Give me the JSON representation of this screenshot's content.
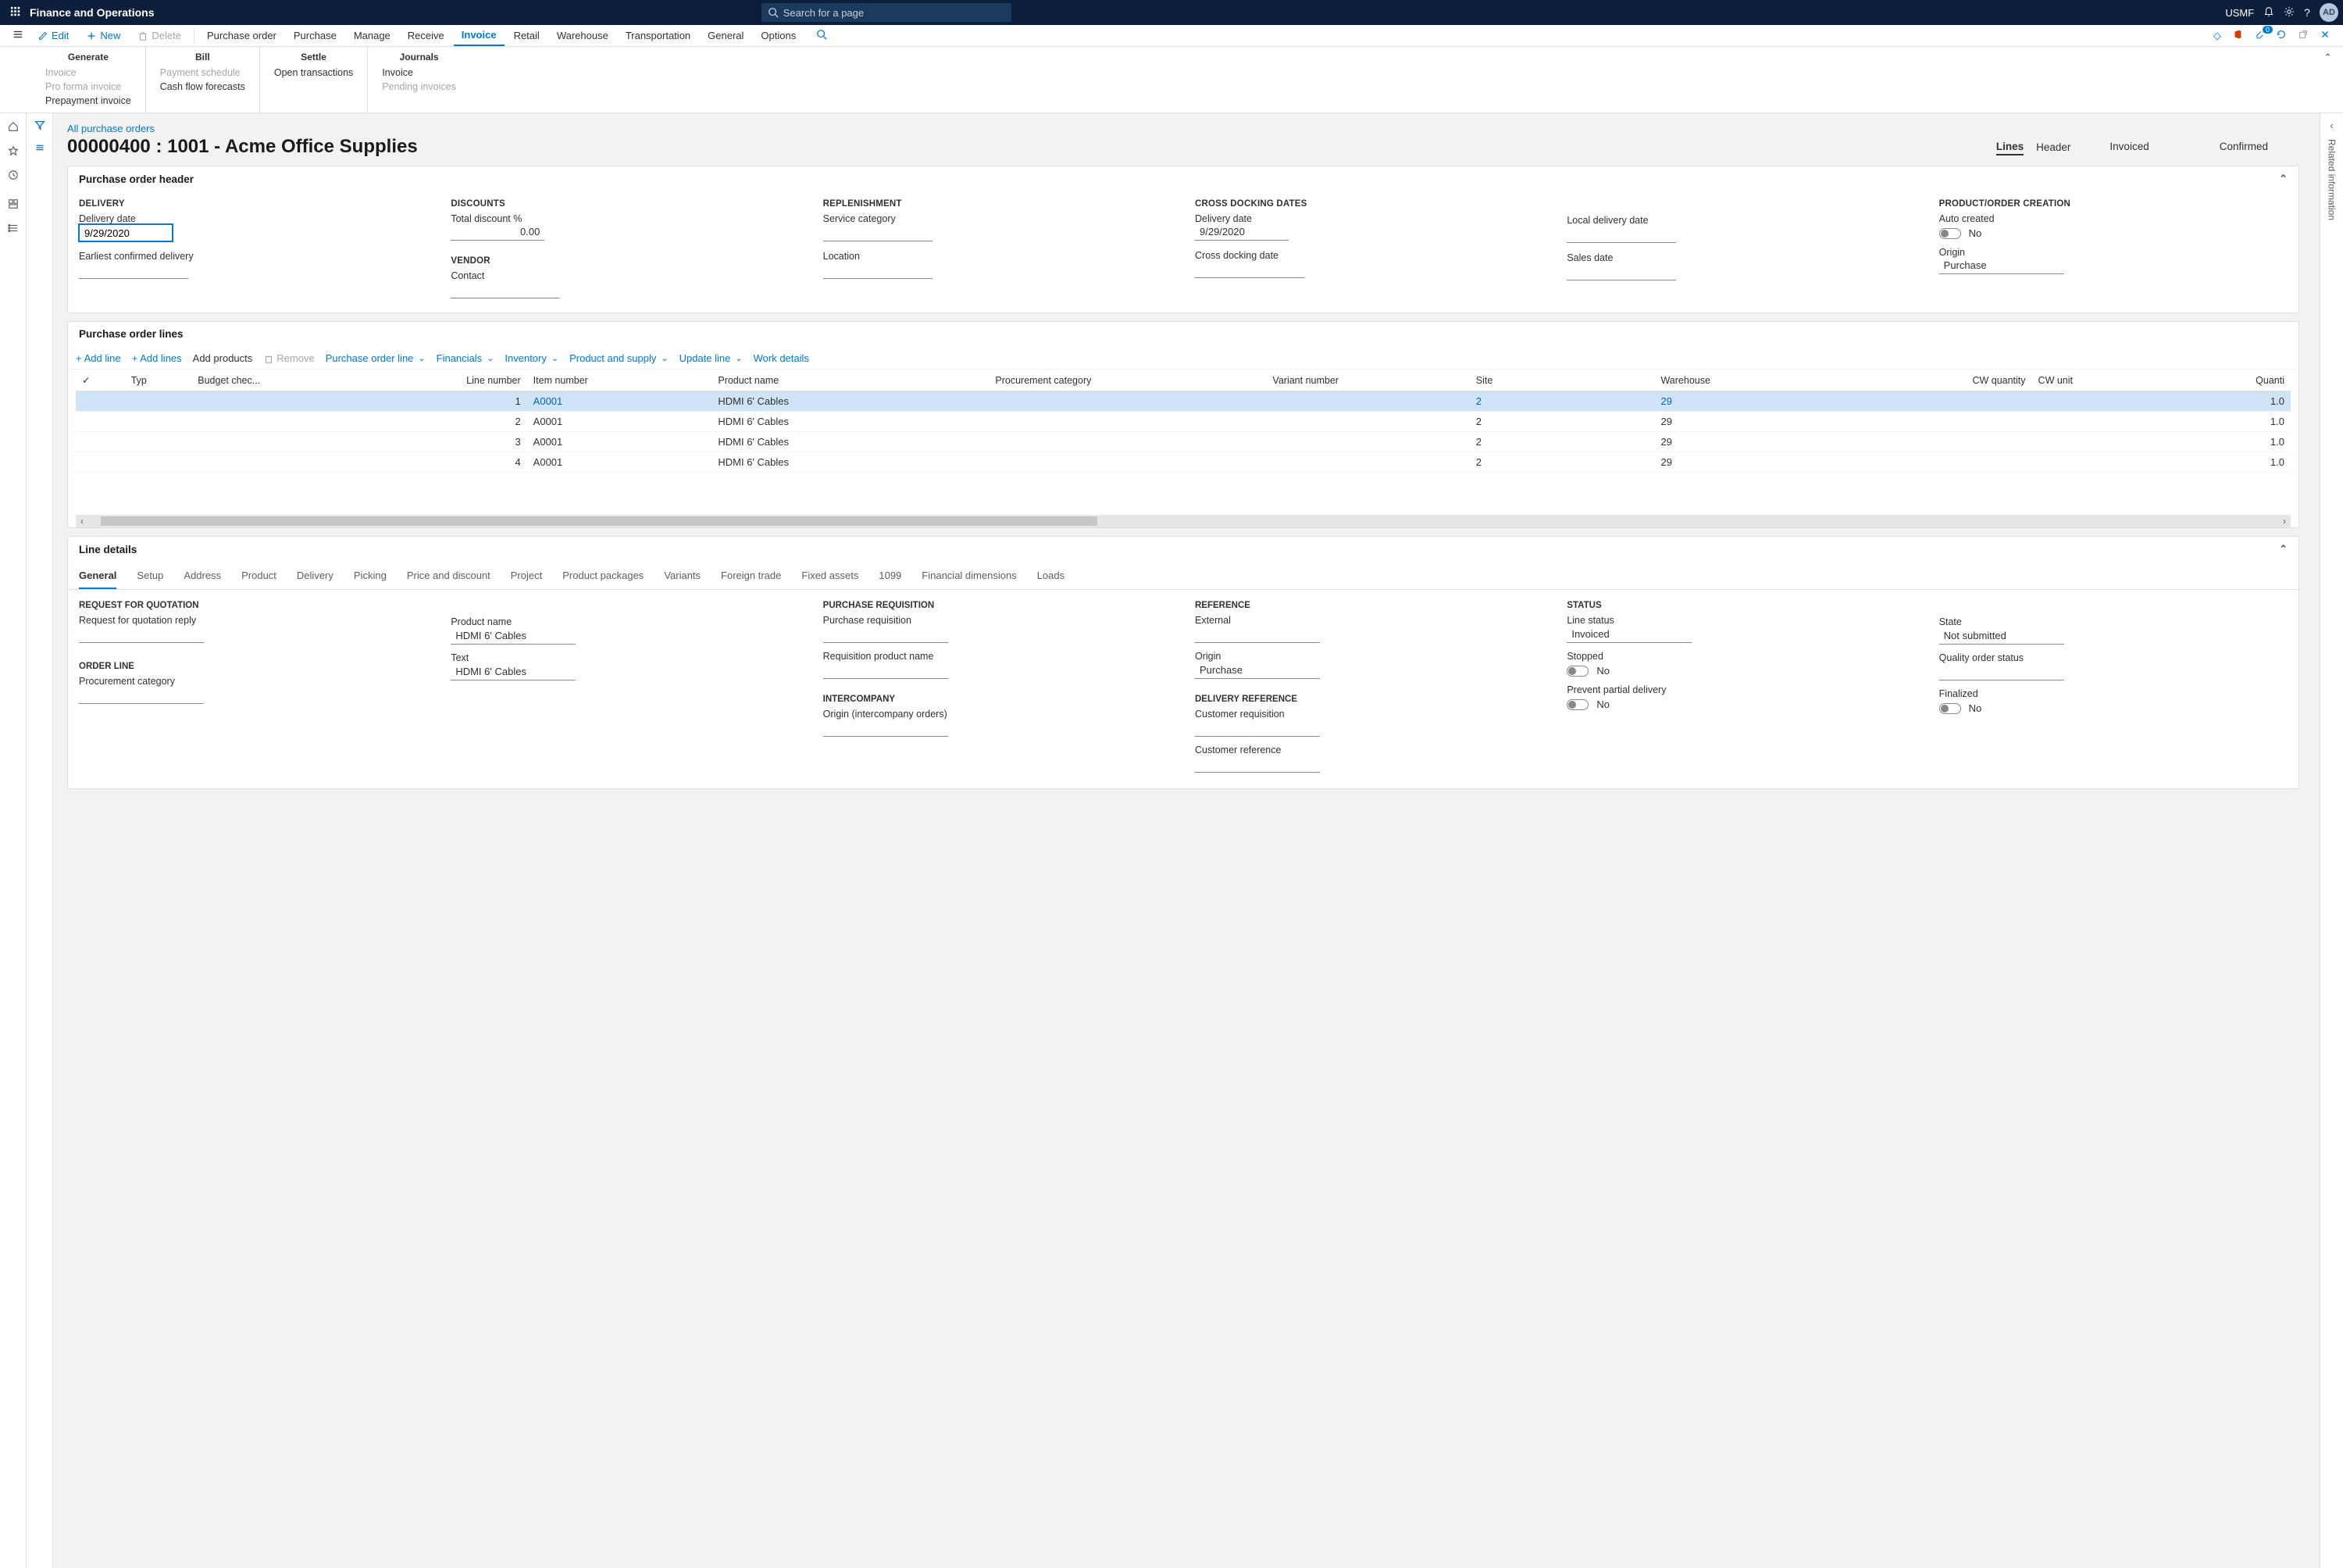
{
  "topbar": {
    "brand": "Finance and Operations",
    "search_placeholder": "Search for a page",
    "company": "USMF",
    "avatar": "AD"
  },
  "actions": {
    "edit": "Edit",
    "new": "New",
    "delete": "Delete",
    "tabs": [
      "Purchase order",
      "Purchase",
      "Manage",
      "Receive",
      "Invoice",
      "Retail",
      "Warehouse",
      "Transportation",
      "General",
      "Options"
    ],
    "active_tab": "Invoice"
  },
  "ribbon": {
    "generate": {
      "title": "Generate",
      "items": [
        "Invoice",
        "Pro forma invoice",
        "Prepayment invoice"
      ]
    },
    "bill": {
      "title": "Bill",
      "items": [
        "Payment schedule",
        "Cash flow forecasts"
      ]
    },
    "settle": {
      "title": "Settle",
      "items": [
        "Open transactions"
      ]
    },
    "journals": {
      "title": "Journals",
      "items": [
        "Invoice",
        "Pending invoices"
      ]
    }
  },
  "breadcrumb": "All purchase orders",
  "page_title": "00000400 : 1001 - Acme Office Supplies",
  "view_tabs": {
    "lines": "Lines",
    "header": "Header"
  },
  "status": {
    "doc_status": "Invoiced",
    "approval": "Confirmed"
  },
  "po_header": {
    "section": "Purchase order header",
    "delivery": {
      "title": "DELIVERY",
      "date_label": "Delivery date",
      "date": "9/29/2020",
      "earliest_label": "Earliest confirmed delivery"
    },
    "discounts": {
      "title": "DISCOUNTS",
      "td_label": "Total discount %",
      "td_value": "0.00"
    },
    "vendor": {
      "title": "VENDOR",
      "contact_label": "Contact"
    },
    "replenishment": {
      "title": "REPLENISHMENT",
      "sc_label": "Service category",
      "loc_label": "Location"
    },
    "cross": {
      "title": "CROSS DOCKING DATES",
      "dd_label": "Delivery date",
      "dd_value": "9/29/2020",
      "cdd_label": "Cross docking date"
    },
    "local": {
      "ldd_label": "Local delivery date",
      "sd_label": "Sales date"
    },
    "product": {
      "title": "PRODUCT/ORDER CREATION",
      "auto_label": "Auto created",
      "auto_value": "No",
      "origin_label": "Origin",
      "origin_value": "Purchase"
    }
  },
  "po_lines": {
    "section": "Purchase order lines",
    "toolbar": {
      "add_line": "Add line",
      "add_lines": "Add lines",
      "add_products": "Add products",
      "remove": "Remove",
      "po_line": "Purchase order line",
      "financials": "Financials",
      "inventory": "Inventory",
      "product_supply": "Product and supply",
      "update_line": "Update line",
      "work_details": "Work details"
    },
    "columns": [
      "Typ",
      "Budget chec...",
      "Line number",
      "Item number",
      "Product name",
      "Procurement category",
      "Variant number",
      "Site",
      "Warehouse",
      "CW quantity",
      "CW unit",
      "Quanti"
    ],
    "rows": [
      {
        "ln": "1",
        "item": "A0001",
        "name": "HDMI 6' Cables",
        "site": "2",
        "wh": "29",
        "qty": "1.0"
      },
      {
        "ln": "2",
        "item": "A0001",
        "name": "HDMI 6' Cables",
        "site": "2",
        "wh": "29",
        "qty": "1.0"
      },
      {
        "ln": "3",
        "item": "A0001",
        "name": "HDMI 6' Cables",
        "site": "2",
        "wh": "29",
        "qty": "1.0"
      },
      {
        "ln": "4",
        "item": "A0001",
        "name": "HDMI 6' Cables",
        "site": "2",
        "wh": "29",
        "qty": "1.0"
      }
    ]
  },
  "line_details": {
    "section": "Line details",
    "tabs": [
      "General",
      "Setup",
      "Address",
      "Product",
      "Delivery",
      "Picking",
      "Price and discount",
      "Project",
      "Product packages",
      "Variants",
      "Foreign trade",
      "Fixed assets",
      "1099",
      "Financial dimensions",
      "Loads"
    ],
    "rfq": {
      "title": "REQUEST FOR QUOTATION",
      "reply_label": "Request for quotation reply"
    },
    "order_line": {
      "title": "ORDER LINE",
      "proc_label": "Procurement category"
    },
    "product": {
      "name_label": "Product name",
      "name_value": "HDMI 6' Cables",
      "text_label": "Text",
      "text_value": "HDMI 6' Cables"
    },
    "pr": {
      "title": "PURCHASE REQUISITION",
      "pr_label": "Purchase requisition",
      "rpn_label": "Requisition product name"
    },
    "inter": {
      "title": "INTERCOMPANY",
      "origin_label": "Origin (intercompany orders)"
    },
    "reference": {
      "title": "REFERENCE",
      "ext_label": "External",
      "origin_label": "Origin",
      "origin_value": "Purchase"
    },
    "del_ref": {
      "title": "DELIVERY REFERENCE",
      "cust_req_label": "Customer requisition",
      "cust_ref_label": "Customer reference"
    },
    "status": {
      "title": "STATUS",
      "ls_label": "Line status",
      "ls_value": "Invoiced",
      "stop_label": "Stopped",
      "stop_value": "No",
      "ppd_label": "Prevent partial delivery",
      "ppd_value": "No"
    },
    "state": {
      "state_label": "State",
      "state_value": "Not submitted",
      "qos_label": "Quality order status",
      "fin_label": "Finalized",
      "fin_value": "No"
    }
  },
  "rightrail": {
    "label": "Related information"
  },
  "badge_count": "0"
}
